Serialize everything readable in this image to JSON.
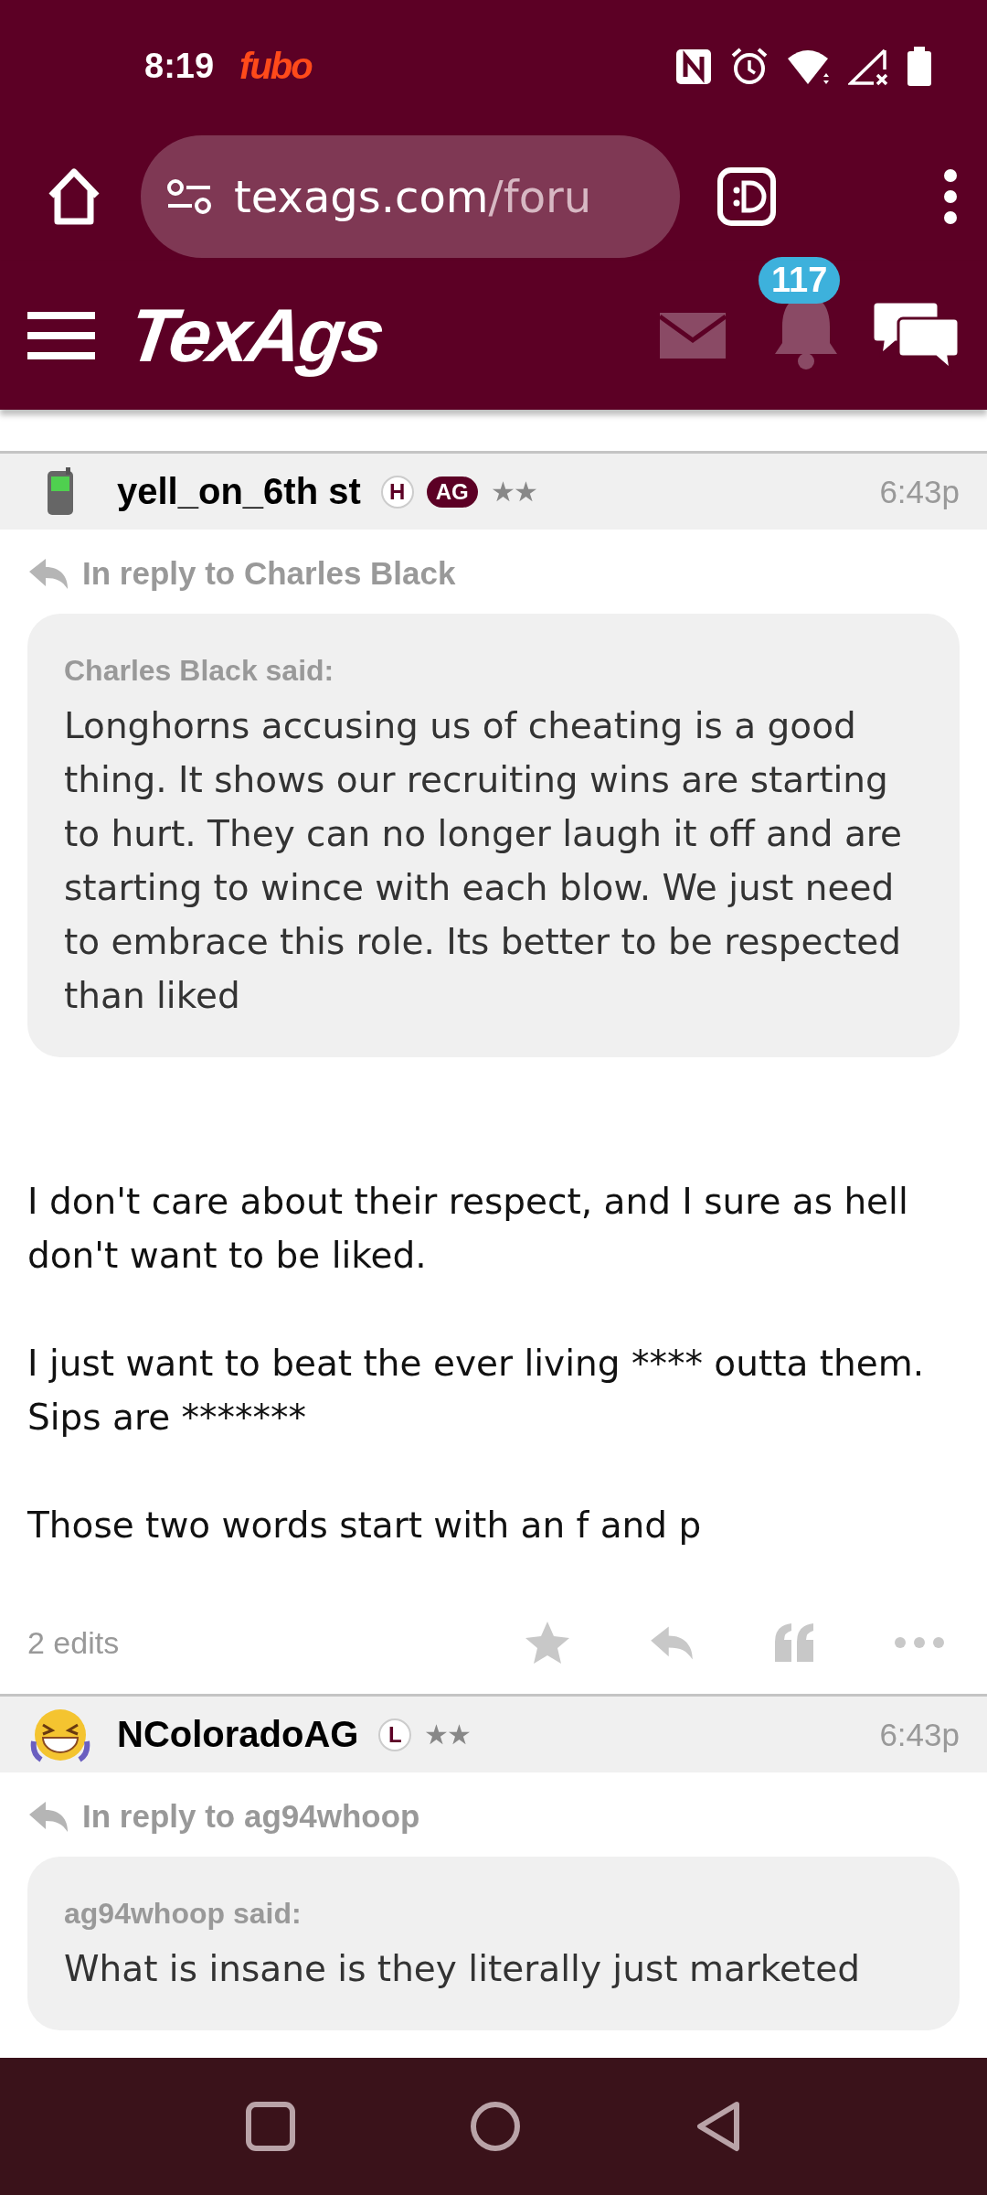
{
  "status_bar": {
    "time": "8:19",
    "app_label": "fubo"
  },
  "browser": {
    "url_host": "texags.com",
    "url_path": "/foru"
  },
  "site_header": {
    "logo": "TexAgs",
    "notification_count": "117"
  },
  "posts": [
    {
      "username": "yell_on_6th st",
      "kind": "phone",
      "badges": [
        {
          "text": "H",
          "kind": "circle"
        },
        {
          "text": "AG",
          "kind": "pill"
        }
      ],
      "rank": "★★",
      "time": "6:43p",
      "reply_to": "In reply to Charles Black",
      "quote_author": "Charles Black said:",
      "quote_text": "Longhorns accusing us of cheating is a good thing. It shows our recruiting wins are starting to hurt. They can no longer laugh it off and are starting to wince with each blow. We just need to embrace this role. Its better to be respected than liked",
      "body": [
        "I don't care about their respect, and I sure as hell don't want to be liked.",
        "I just want to beat the ever living **** outta them. Sips are *******",
        "Those two words start with an f and p"
      ],
      "edits": "2 edits"
    },
    {
      "username": "NColoradoAG",
      "kind": "laughing",
      "badges": [
        {
          "text": "L",
          "kind": "circle"
        }
      ],
      "rank": "★★",
      "time": "6:43p",
      "reply_to": "In reply to ag94whoop",
      "quote_author": "ag94whoop said:",
      "quote_text": "What is insane is they literally just marketed"
    }
  ]
}
